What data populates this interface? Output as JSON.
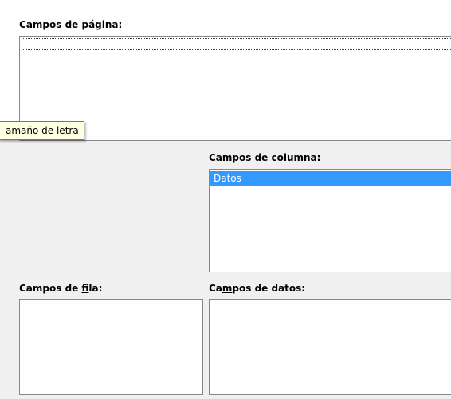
{
  "page_fields": {
    "label_prefix": "",
    "label_mnemonic": "C",
    "label_rest": "ampos de página:"
  },
  "tooltip": {
    "text": "amaño de letra"
  },
  "column_fields": {
    "label_prefix": "Campos ",
    "label_mnemonic": "d",
    "label_rest": "e columna:",
    "items": [
      {
        "label": "Datos",
        "selected": true
      }
    ]
  },
  "row_fields": {
    "label_prefix": "Campos de ",
    "label_mnemonic": "f",
    "label_rest": "ila:"
  },
  "data_fields": {
    "label_prefix": "Ca",
    "label_mnemonic": "m",
    "label_rest": "pos de datos:"
  },
  "colors": {
    "selection": "#3399ff",
    "tooltip_bg": "#ffffe1",
    "dialog_bg": "#f0f0f0"
  }
}
